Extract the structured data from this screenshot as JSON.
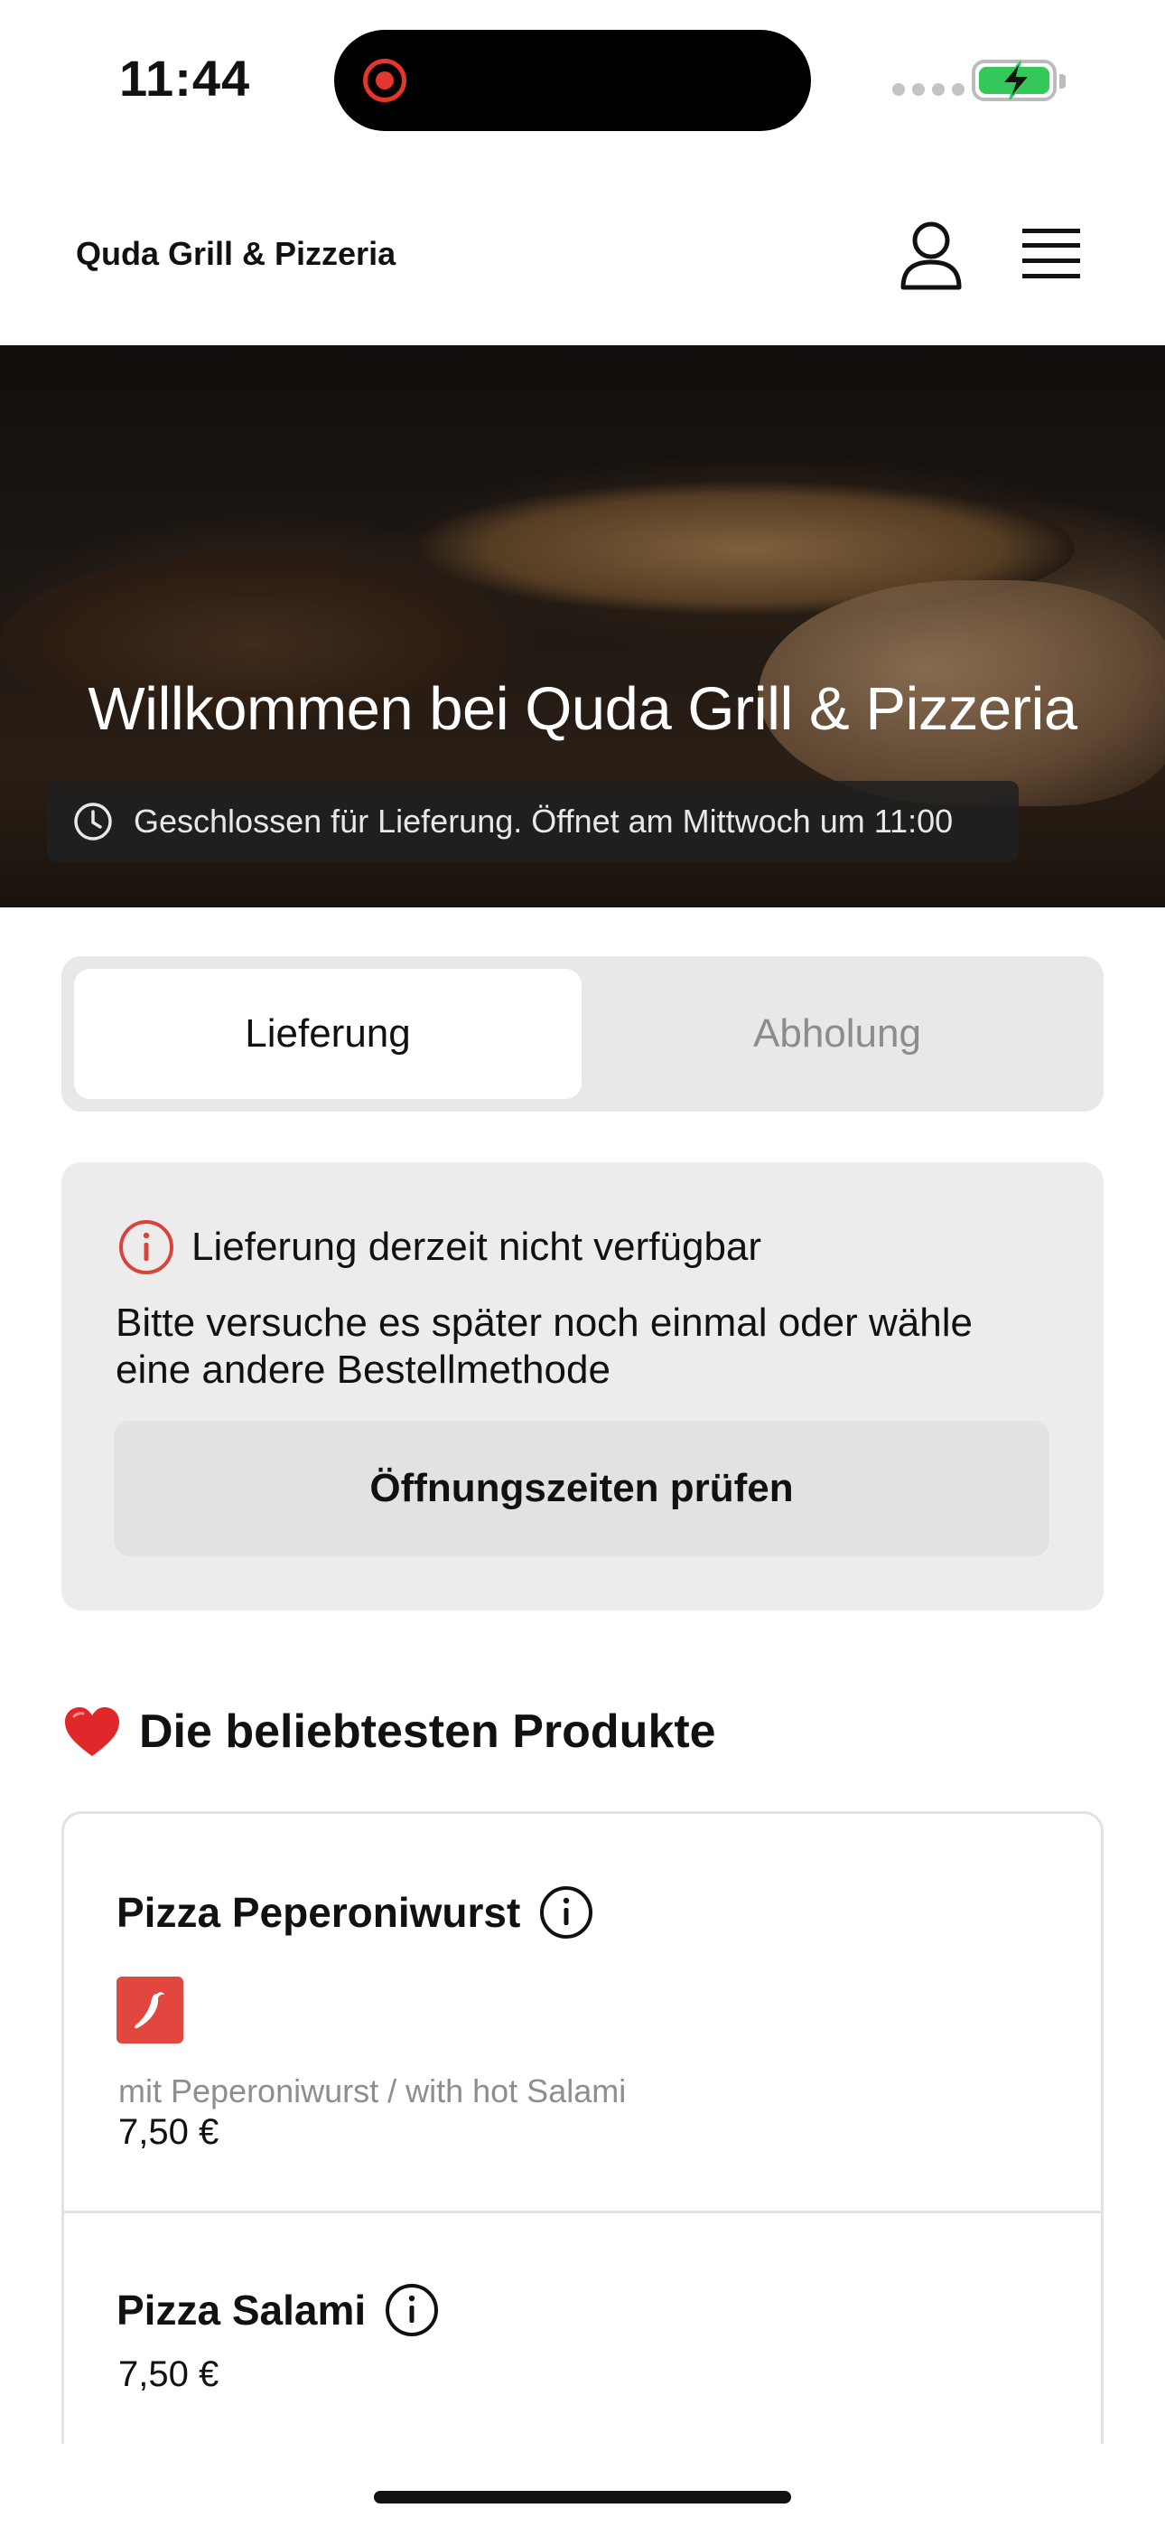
{
  "status_bar": {
    "time": "11:44"
  },
  "header": {
    "brand": "Quda Grill & Pizzeria",
    "icons": [
      "user-icon",
      "hamburger-menu-icon"
    ]
  },
  "hero": {
    "title": "Willkommen bei Quda Grill & Pizzeria",
    "status_text": "Geschlossen für Lieferung. Öffnet am Mittwoch um 11:00"
  },
  "order_method": {
    "options": [
      {
        "label": "Lieferung",
        "selected": true
      },
      {
        "label": "Abholung",
        "selected": false
      }
    ]
  },
  "notice": {
    "title": "Lieferung derzeit nicht verfügbar",
    "body": "Bitte versuche es später noch einmal oder wähle eine andere Bestellmethode",
    "button": "Öffnungszeiten prüfen"
  },
  "popular": {
    "title": "Die beliebtesten Produkte",
    "products": [
      {
        "name": "Pizza Peperoniwurst",
        "badge": "chili-icon",
        "description": "mit Peperoniwurst / with hot Salami",
        "price": "7,50 €"
      },
      {
        "name": "Pizza Salami",
        "price": "7,50 €"
      }
    ]
  },
  "colors": {
    "accent_red": "#e2473f",
    "battery_green": "#34c759"
  }
}
